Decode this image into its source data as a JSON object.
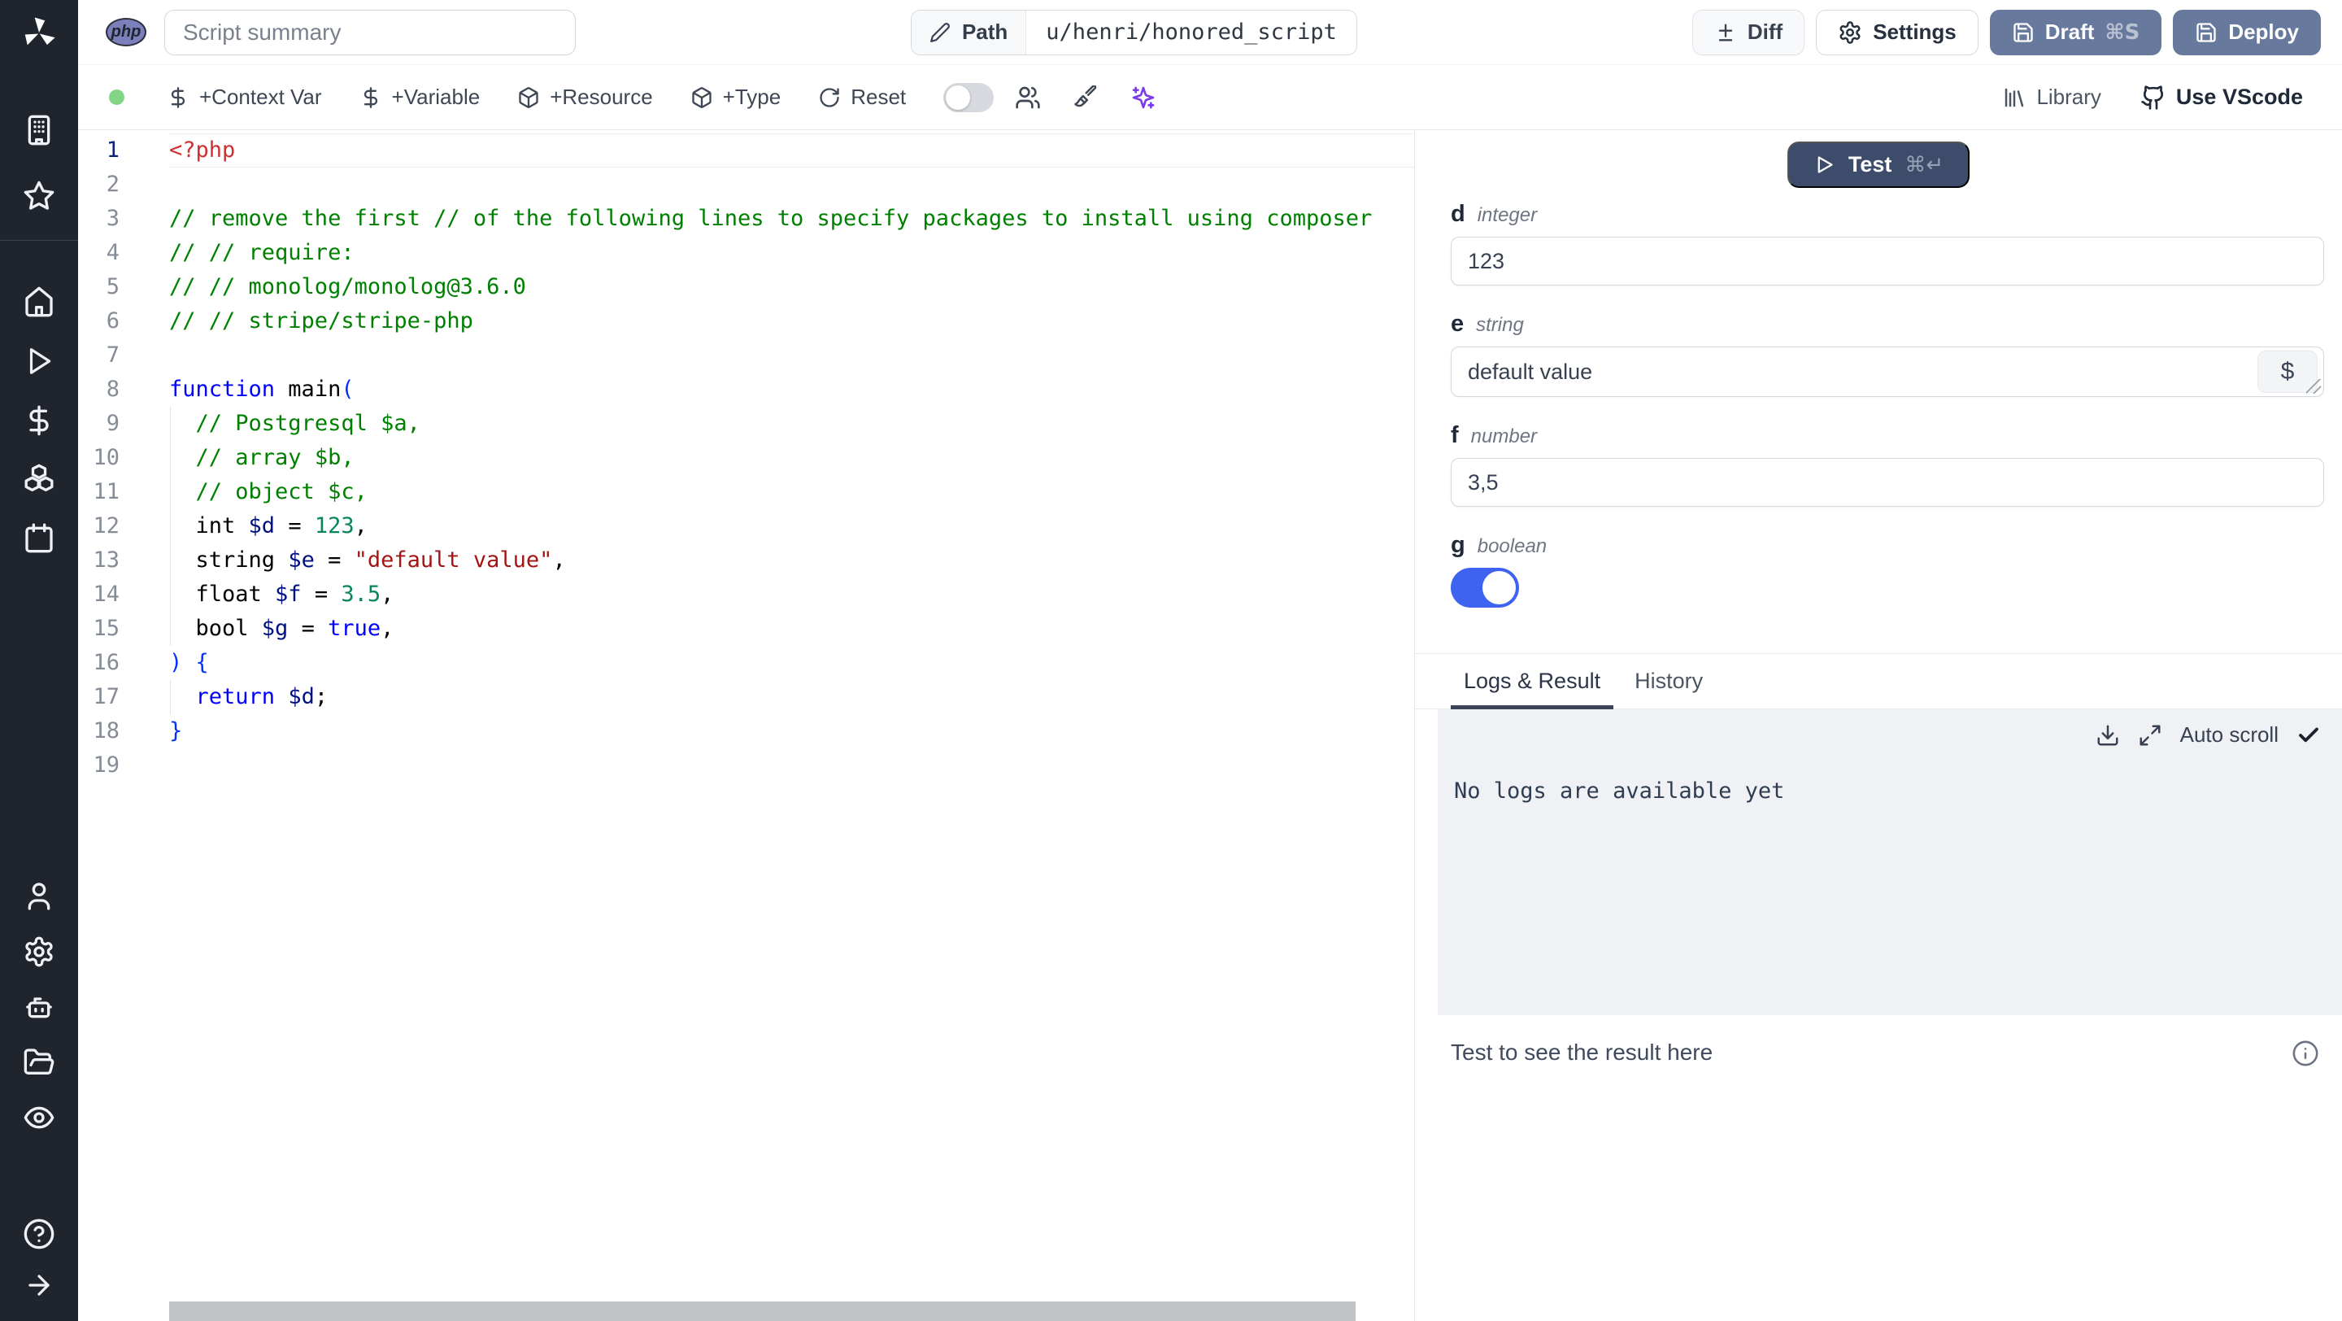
{
  "header": {
    "language_badge": "php",
    "summary_placeholder": "Script summary",
    "path_label": "Path",
    "path_value": "u/henri/honored_script",
    "diff_label": "Diff",
    "settings_label": "Settings",
    "draft_label": "Draft",
    "draft_shortcut": "⌘S",
    "deploy_label": "Deploy"
  },
  "toolbar": {
    "status_color": "#83d487",
    "add_context_var": "+Context Var",
    "add_variable": "+Variable",
    "add_resource": "+Resource",
    "add_type": "+Type",
    "reset": "Reset",
    "library": "Library",
    "use_vscode": "Use VScode",
    "icons": [
      "diff-toggle",
      "users-icon",
      "paintbrush-icon",
      "sparkles-icon"
    ]
  },
  "sidebar": {
    "icons": [
      "windmill-logo",
      "building-icon",
      "star-icon",
      "home-icon",
      "play-icon",
      "dollar-icon",
      "boxes-icon",
      "calendar-icon",
      "user-icon",
      "gear-icon",
      "robot-icon",
      "folder-icon",
      "eye-icon",
      "help-icon",
      "arrow-right-icon"
    ]
  },
  "editor": {
    "language": "php",
    "lines": [
      {
        "n": 1,
        "active": true,
        "tokens": [
          {
            "t": "<?php",
            "c": "meta"
          }
        ]
      },
      {
        "n": 2,
        "tokens": []
      },
      {
        "n": 3,
        "tokens": [
          {
            "t": "// remove the first // of the following lines to specify packages to install using composer",
            "c": "cm"
          }
        ]
      },
      {
        "n": 4,
        "tokens": [
          {
            "t": "// // require:",
            "c": "cm"
          }
        ]
      },
      {
        "n": 5,
        "tokens": [
          {
            "t": "// // monolog/monolog@3.6.0",
            "c": "cm"
          }
        ]
      },
      {
        "n": 6,
        "tokens": [
          {
            "t": "// // stripe/stripe-php",
            "c": "cm"
          }
        ]
      },
      {
        "n": 7,
        "tokens": []
      },
      {
        "n": 8,
        "tokens": [
          {
            "t": "function",
            "c": "kw"
          },
          {
            "t": " main",
            "c": "pl"
          },
          {
            "t": "(",
            "c": "br"
          }
        ]
      },
      {
        "n": 9,
        "guide": true,
        "tokens": [
          {
            "t": "  ",
            "c": "pl"
          },
          {
            "t": "// Postgresql $a,",
            "c": "cm"
          }
        ]
      },
      {
        "n": 10,
        "guide": true,
        "tokens": [
          {
            "t": "  ",
            "c": "pl"
          },
          {
            "t": "// array $b,",
            "c": "cm"
          }
        ]
      },
      {
        "n": 11,
        "guide": true,
        "tokens": [
          {
            "t": "  ",
            "c": "pl"
          },
          {
            "t": "// object $c,",
            "c": "cm"
          }
        ]
      },
      {
        "n": 12,
        "guide": true,
        "tokens": [
          {
            "t": "  int ",
            "c": "pl"
          },
          {
            "t": "$d",
            "c": "var"
          },
          {
            "t": " = ",
            "c": "pl"
          },
          {
            "t": "123",
            "c": "num"
          },
          {
            "t": ",",
            "c": "pl"
          }
        ]
      },
      {
        "n": 13,
        "guide": true,
        "tokens": [
          {
            "t": "  string ",
            "c": "pl"
          },
          {
            "t": "$e",
            "c": "var"
          },
          {
            "t": " = ",
            "c": "pl"
          },
          {
            "t": "\"default value\"",
            "c": "str"
          },
          {
            "t": ",",
            "c": "pl"
          }
        ]
      },
      {
        "n": 14,
        "guide": true,
        "tokens": [
          {
            "t": "  float ",
            "c": "pl"
          },
          {
            "t": "$f",
            "c": "var"
          },
          {
            "t": " = ",
            "c": "pl"
          },
          {
            "t": "3.5",
            "c": "num"
          },
          {
            "t": ",",
            "c": "pl"
          }
        ]
      },
      {
        "n": 15,
        "guide": true,
        "tokens": [
          {
            "t": "  bool ",
            "c": "pl"
          },
          {
            "t": "$g",
            "c": "var"
          },
          {
            "t": " = ",
            "c": "pl"
          },
          {
            "t": "true",
            "c": "kw"
          },
          {
            "t": ",",
            "c": "pl"
          }
        ]
      },
      {
        "n": 16,
        "tokens": [
          {
            "t": ") {",
            "c": "br"
          }
        ]
      },
      {
        "n": 17,
        "guide": true,
        "tokens": [
          {
            "t": "  ",
            "c": "pl"
          },
          {
            "t": "return",
            "c": "kw"
          },
          {
            "t": " ",
            "c": "pl"
          },
          {
            "t": "$d",
            "c": "var"
          },
          {
            "t": ";",
            "c": "pl"
          }
        ]
      },
      {
        "n": 18,
        "tokens": [
          {
            "t": "}",
            "c": "br"
          }
        ]
      },
      {
        "n": 19,
        "tokens": []
      }
    ]
  },
  "run_panel": {
    "test_label": "Test",
    "test_shortcut": "⌘↵",
    "fields": [
      {
        "name": "d",
        "type": "integer",
        "value": "123",
        "control": "input"
      },
      {
        "name": "e",
        "type": "string",
        "value": "default value",
        "control": "textarea",
        "suffix_button": "$"
      },
      {
        "name": "f",
        "type": "number",
        "value": "3,5",
        "control": "input"
      },
      {
        "name": "g",
        "type": "boolean",
        "value": true,
        "control": "toggle"
      }
    ],
    "tabs": [
      {
        "label": "Logs & Result",
        "active": true
      },
      {
        "label": "History",
        "active": false
      }
    ],
    "logs": {
      "auto_scroll_label": "Auto scroll",
      "auto_scroll_checked": true,
      "empty_message": "No logs are available yet",
      "icons": [
        "download-icon",
        "expand-icon",
        "check-icon"
      ]
    },
    "result": {
      "placeholder": "Test to see the result here"
    }
  },
  "colors": {
    "primary_button": "#67799c",
    "test_button": "#3d4c6b",
    "toggle_on": "#3e63f0",
    "status_green": "#83d487",
    "php_badge": "#7b80ba",
    "ai_sparkles": "#7c3aed"
  }
}
